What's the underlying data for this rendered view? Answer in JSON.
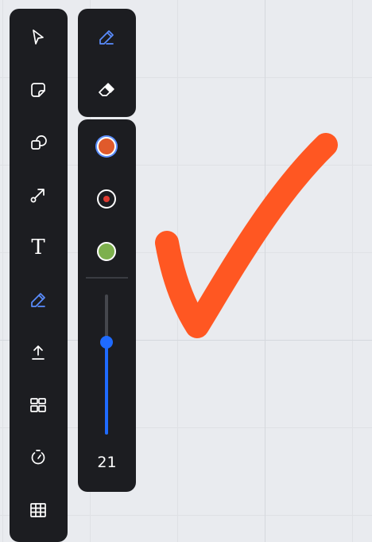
{
  "toolbar": {
    "tools": [
      {
        "name": "select-tool",
        "icon": "cursor-icon"
      },
      {
        "name": "sticky-note-tool",
        "icon": "sticky-note-icon"
      },
      {
        "name": "shapes-tool",
        "icon": "shapes-icon"
      },
      {
        "name": "connector-tool",
        "icon": "connector-arrow-icon"
      },
      {
        "name": "text-tool",
        "icon": "text-icon",
        "glyph": "T"
      },
      {
        "name": "pen-tool",
        "icon": "pen-icon",
        "active": true
      },
      {
        "name": "upload-tool",
        "icon": "upload-icon"
      },
      {
        "name": "templates-tool",
        "icon": "templates-grid-icon"
      },
      {
        "name": "timer-tool",
        "icon": "timer-icon"
      },
      {
        "name": "table-tool",
        "icon": "table-icon"
      }
    ]
  },
  "mode_panel": {
    "modes": [
      {
        "name": "pen-mode",
        "icon": "pen-icon",
        "active": true
      },
      {
        "name": "eraser-mode",
        "icon": "eraser-icon"
      }
    ]
  },
  "pen_panel": {
    "colors": [
      {
        "name": "orange",
        "hex": "#e05a2b",
        "selected": true
      },
      {
        "name": "red",
        "hex": "#e03a30",
        "style": "ring"
      },
      {
        "name": "green",
        "hex": "#7db04d"
      }
    ],
    "size": {
      "value": 21,
      "label": "21",
      "fill_fraction": 0.66
    }
  },
  "canvas": {
    "stroke_color": "#ff5722",
    "shape": "checkmark"
  },
  "colors": {
    "accent": "#1f6bff",
    "active_icon": "#5a8dff",
    "panel_bg": "#1c1d21",
    "canvas_bg": "#e9ebef"
  }
}
